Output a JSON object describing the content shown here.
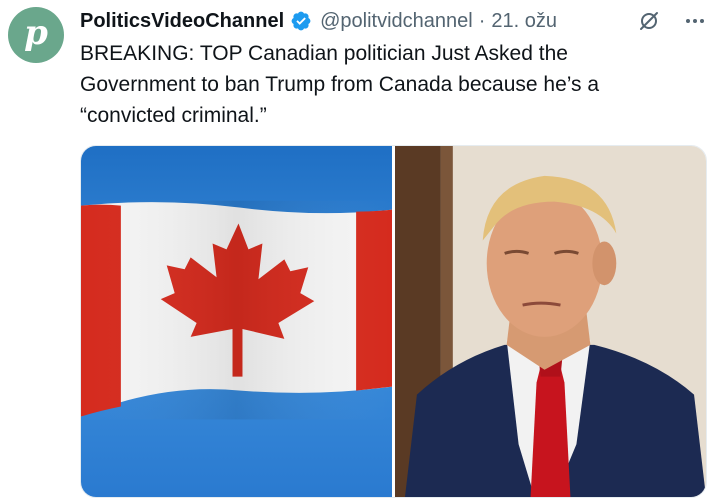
{
  "tweet": {
    "author_name": "PoliticsVideoChannel",
    "avatar_letter": "p",
    "verified": true,
    "handle": "@politvidchannel",
    "separator": "·",
    "date": "21. ožu",
    "text": "BREAKING: TOP Canadian politician Just Asked the\nGovernment to ban Trump from Canada because he’s a\n“convicted criminal.”",
    "icons": [
      "verified-badge-icon",
      "grok-icon",
      "more-icon"
    ]
  },
  "media": {
    "images": [
      {
        "name": "canada-flag-photo",
        "description_icon": "canada-flag"
      },
      {
        "name": "politician-portrait-photo",
        "description_icon": "portrait"
      }
    ]
  },
  "colors": {
    "avatar_bg": "#6aa78c",
    "verified": "#1d9bf0",
    "secondary_text": "#536471",
    "flag_red": "#d52b1e"
  }
}
